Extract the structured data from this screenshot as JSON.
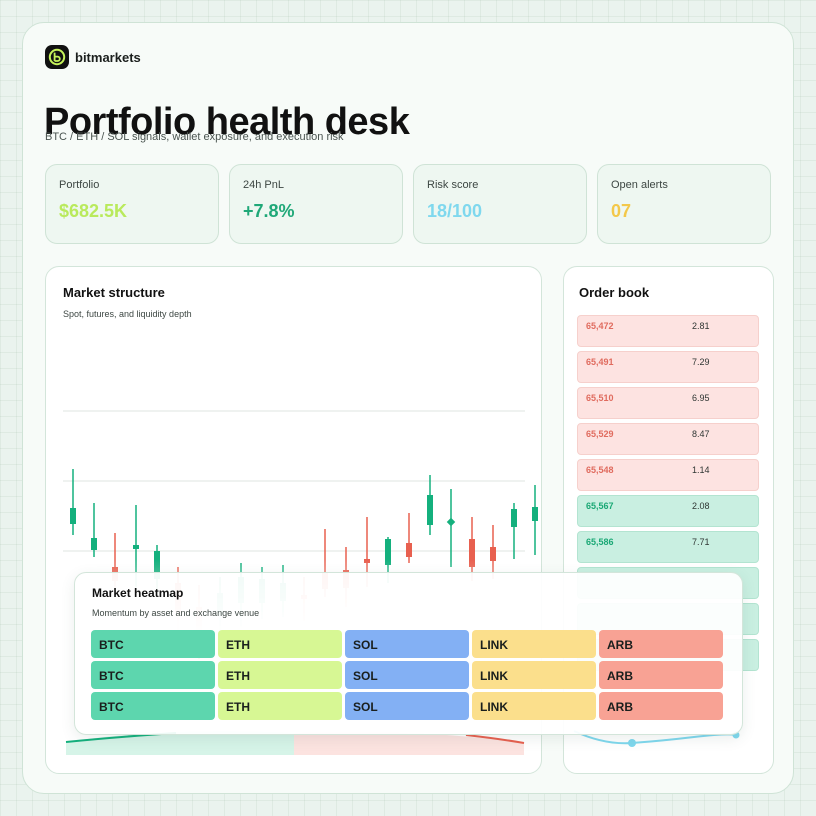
{
  "brand": {
    "name": "bitmarkets",
    "logo_icon": "bitmarkets-logo-icon"
  },
  "page": {
    "title": "Portfolio health desk",
    "subtitle": "BTC / ETH / SOL signals, wallet exposure, and execution risk"
  },
  "kpis": [
    {
      "label": "Portfolio",
      "value": "$682.5K",
      "color": "#b9ea5c"
    },
    {
      "label": "24h PnL",
      "value": "+7.8%",
      "color": "#1fa878"
    },
    {
      "label": "Risk score",
      "value": "18/100",
      "color": "#7fd8ee"
    },
    {
      "label": "Open alerts",
      "value": "07",
      "color": "#f3c84a"
    }
  ],
  "market_structure": {
    "title": "Market structure",
    "subtitle": "Spot, futures, and liquidity depth"
  },
  "order_book": {
    "title": "Order book",
    "rows": [
      {
        "price": "65,472",
        "size": "2.81",
        "side": "ask"
      },
      {
        "price": "65,491",
        "size": "7.29",
        "side": "ask"
      },
      {
        "price": "65,510",
        "size": "6.95",
        "side": "ask"
      },
      {
        "price": "65,529",
        "size": "8.47",
        "side": "ask"
      },
      {
        "price": "65,548",
        "size": "1.14",
        "side": "ask"
      },
      {
        "price": "65,567",
        "size": "2.08",
        "side": "bid"
      },
      {
        "price": "65,586",
        "size": "7.71",
        "side": "bid"
      }
    ]
  },
  "heatmap": {
    "title": "Market heatmap",
    "subtitle": "Momentum by asset and exchange venue",
    "rows": [
      [
        "BTC",
        "ETH",
        "SOL",
        "LINK",
        "ARB"
      ],
      [
        "BTC",
        "ETH",
        "SOL",
        "LINK",
        "ARB"
      ],
      [
        "BTC",
        "ETH",
        "SOL",
        "LINK",
        "ARB"
      ]
    ],
    "colors": [
      "#5dd6ae",
      "#d7f794",
      "#83b0f4",
      "#fbdf8c",
      "#f8a294"
    ]
  },
  "colors": {
    "up": "#14b07d",
    "down": "#e8604f"
  }
}
